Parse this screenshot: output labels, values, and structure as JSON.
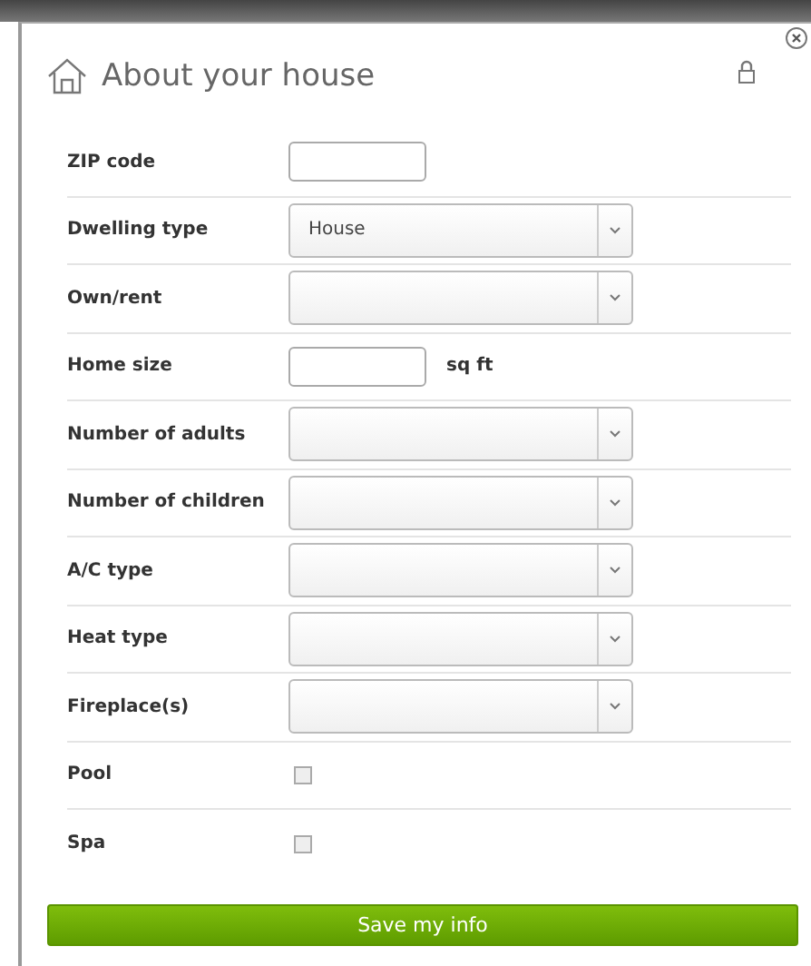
{
  "dialog": {
    "title": "About your house"
  },
  "fields": [
    {
      "label": "ZIP code",
      "kind": "text"
    },
    {
      "label": "Dwelling type",
      "kind": "select",
      "value": "House"
    },
    {
      "label": "Own/rent",
      "kind": "select"
    },
    {
      "label": "Home size",
      "kind": "text",
      "unit": "sq ft"
    },
    {
      "label": "Number of adults",
      "kind": "select"
    },
    {
      "label": "Number of children",
      "kind": "select"
    },
    {
      "label": "A/C type",
      "kind": "select"
    },
    {
      "label": "Heat type",
      "kind": "select"
    },
    {
      "label": "Fireplace(s)",
      "kind": "select"
    },
    {
      "label": "Pool",
      "kind": "checkbox",
      "checked": false
    },
    {
      "label": "Spa",
      "kind": "checkbox",
      "checked": false
    }
  ],
  "save_button": "Save my info"
}
